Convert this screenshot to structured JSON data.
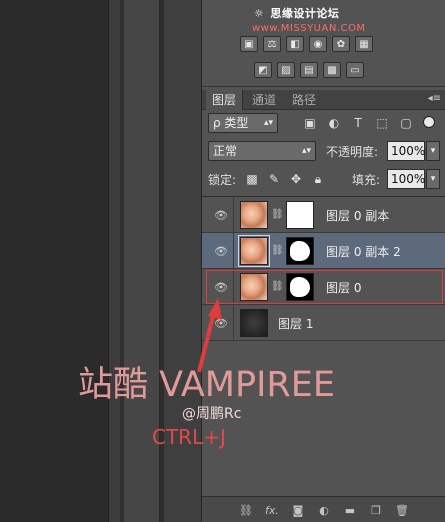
{
  "watermark": {
    "text": "思缘设计论坛",
    "site": "www.MISSYUAN.COM"
  },
  "panel": {
    "tabs": [
      {
        "label": "图层"
      },
      {
        "label": "通道"
      },
      {
        "label": "路径"
      }
    ],
    "filter": {
      "label": "ρ 类型"
    },
    "filter_icons": [
      "image-filter-icon",
      "adjustment-filter-icon",
      "text-filter-icon",
      "shape-filter-icon",
      "smart-object-filter-icon"
    ],
    "blend": {
      "mode": "正常",
      "opacity_label": "不透明度:",
      "opacity_value": "100%"
    },
    "lock": {
      "label": "锁定:",
      "fill_label": "填充:",
      "fill_value": "100%"
    },
    "layers": [
      {
        "name": "图层 0 副本",
        "visible": true,
        "selected": false,
        "mask": "white"
      },
      {
        "name": "图层 0 副本 2",
        "visible": true,
        "selected": true,
        "mask": "shape"
      },
      {
        "name": "图层 0",
        "visible": true,
        "selected": false,
        "mask": "shape"
      },
      {
        "name": "图层 1",
        "visible": true,
        "selected": false,
        "mask": "none"
      }
    ],
    "bottom_icons": [
      "link-layers-icon",
      "fx-icon",
      "add-mask-icon",
      "adjustment-layer-icon",
      "group-folder-icon",
      "new-layer-icon",
      "trash-icon"
    ]
  },
  "overlay": {
    "title": "站酷 VAMPIREE",
    "author": "@周鹏Rc",
    "shortcut": "CTRL+J"
  },
  "colors": {
    "panel_bg": "#535353",
    "selected_layer": "#5d6a7c",
    "annotation_red": "#e23b3b",
    "title_pink": "#e09a9a"
  }
}
